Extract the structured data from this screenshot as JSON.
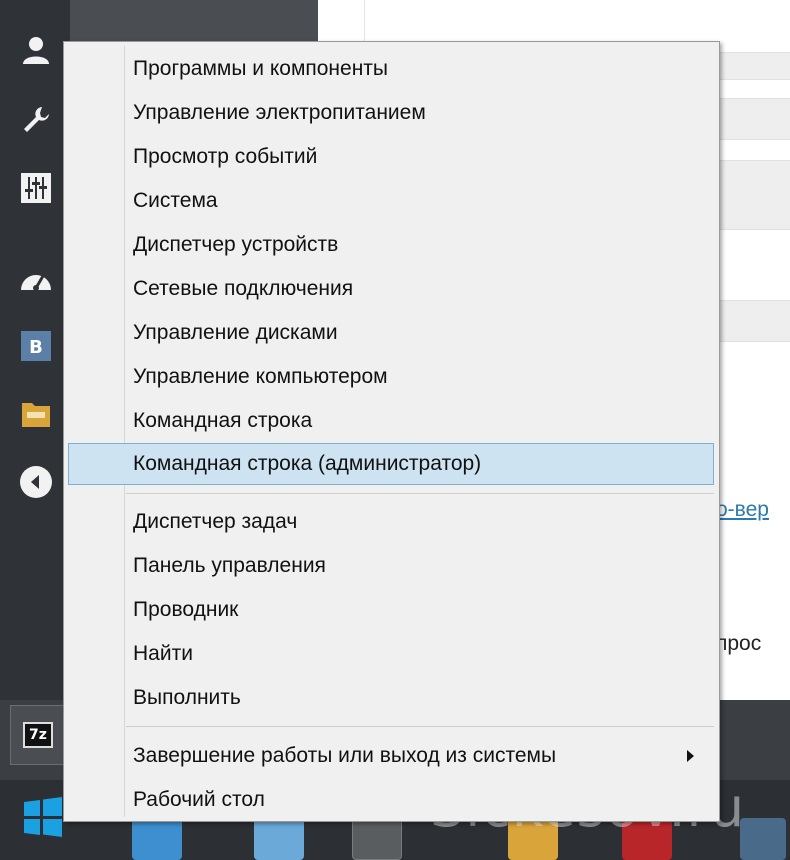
{
  "menu": {
    "group1": [
      {
        "label": "Программы и компоненты"
      },
      {
        "label": "Управление электропитанием"
      },
      {
        "label": "Просмотр событий"
      },
      {
        "label": "Система"
      },
      {
        "label": "Диспетчер устройств"
      },
      {
        "label": "Сетевые подключения"
      },
      {
        "label": "Управление дисками"
      },
      {
        "label": "Управление компьютером"
      },
      {
        "label": "Командная строка"
      },
      {
        "label": "Командная строка (администратор)",
        "selected": true
      }
    ],
    "group2": [
      {
        "label": "Диспетчер задач"
      },
      {
        "label": "Панель управления"
      },
      {
        "label": "Проводник"
      },
      {
        "label": "Найти"
      },
      {
        "label": "Выполнить"
      }
    ],
    "group3": [
      {
        "label": "Завершение работы или выход из системы",
        "has_submenu": true
      },
      {
        "label": "Рабочий стол"
      }
    ]
  },
  "background": {
    "link_fragment": "о-вер",
    "text_fragment": "прос"
  },
  "taskbar": {
    "sevenzip_label": "7z"
  },
  "watermark": "Sickesov.ru",
  "colors": {
    "selection_bg": "#cde3f1",
    "selection_border": "#7fb0d3",
    "menu_bg": "#f0f0f0",
    "link": "#2a7ab0"
  },
  "side_icons": [
    "user-icon",
    "wrench-icon",
    "sliders-icon",
    "gauge-icon",
    "vk-icon",
    "folder-icon",
    "back-arrow-icon"
  ]
}
